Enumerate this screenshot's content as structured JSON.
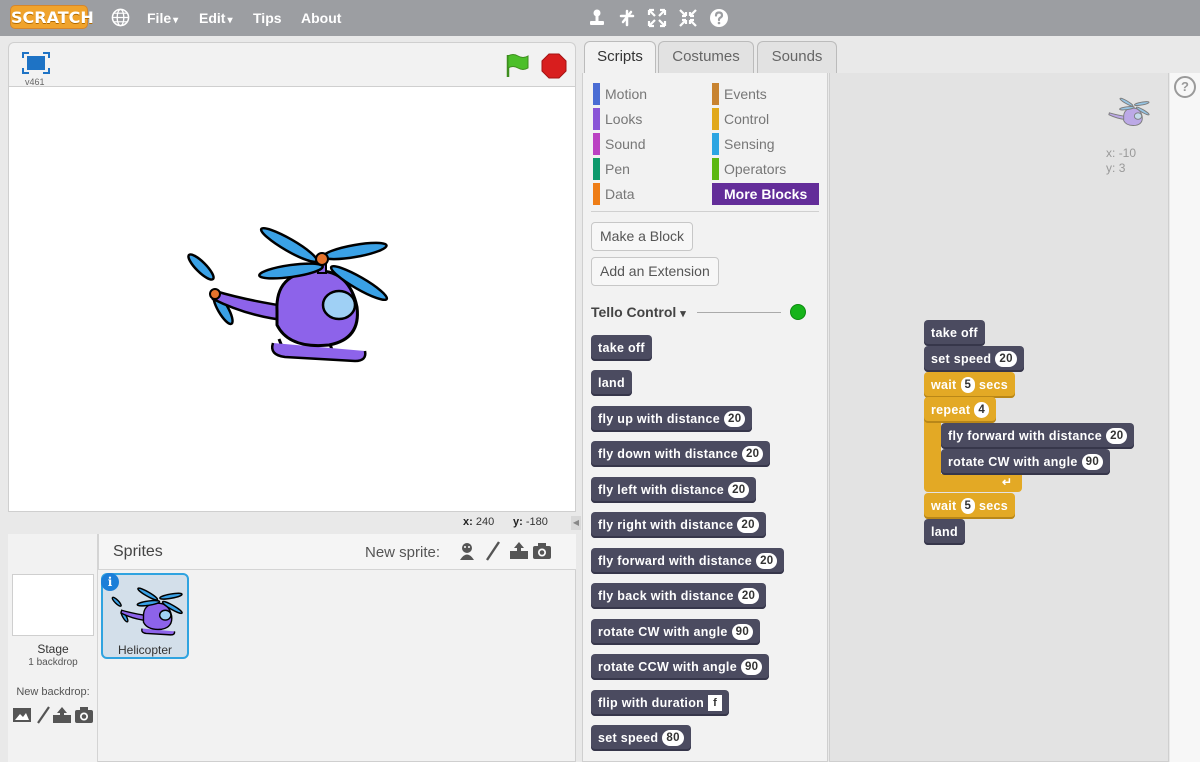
{
  "topbar": {
    "logo": "SCRATCH",
    "menu": [
      {
        "label": "File",
        "arrow": "▾"
      },
      {
        "label": "Edit",
        "arrow": "▾"
      },
      {
        "label": "Tips",
        "arrow": ""
      },
      {
        "label": "About",
        "arrow": ""
      }
    ],
    "tools": [
      "duplicate-stamp-icon",
      "delete-scissors-icon",
      "grow-icon",
      "shrink-icon",
      "help-icon"
    ]
  },
  "stage": {
    "version": "v461",
    "mouse_x_label": "x:",
    "mouse_x": "240",
    "mouse_y_label": "y:",
    "mouse_y": "-180"
  },
  "sprites_pane": {
    "title": "Sprites",
    "new_sprite_label": "New sprite:",
    "stage_label": "Stage",
    "backdrop_count": "1 backdrop",
    "new_backdrop_label": "New backdrop:",
    "sprite_name": "Helicopter",
    "info_glyph": "i"
  },
  "tabs": [
    {
      "label": "Scripts",
      "active": true
    },
    {
      "label": "Costumes",
      "active": false
    },
    {
      "label": "Sounds",
      "active": false
    }
  ],
  "categories": [
    {
      "label": "Motion",
      "color": "#4a6cd4"
    },
    {
      "label": "Looks",
      "color": "#8a55d7"
    },
    {
      "label": "Sound",
      "color": "#bb42c3"
    },
    {
      "label": "Pen",
      "color": "#0e9a6c"
    },
    {
      "label": "Data",
      "color": "#ee7d16"
    },
    {
      "label": "Events",
      "color": "#c88330"
    },
    {
      "label": "Control",
      "color": "#e1a91a"
    },
    {
      "label": "Sensing",
      "color": "#2ca5e2"
    },
    {
      "label": "Operators",
      "color": "#5cb712"
    },
    {
      "label": "More Blocks",
      "color": "#632d99",
      "active": true
    }
  ],
  "palette": {
    "make_block": "Make a Block",
    "add_extension": "Add an Extension",
    "extension_title": "Tello Control",
    "extension_arrow": "▾",
    "blocks": [
      {
        "text": "take off"
      },
      {
        "text": "land"
      },
      {
        "text": "fly up with distance",
        "value": "20"
      },
      {
        "text": "fly down with distance",
        "value": "20"
      },
      {
        "text": "fly left with distance",
        "value": "20"
      },
      {
        "text": "fly right with distance",
        "value": "20"
      },
      {
        "text": "fly forward with distance",
        "value": "20"
      },
      {
        "text": "fly back with distance",
        "value": "20"
      },
      {
        "text": "rotate CW with angle",
        "value": "90"
      },
      {
        "text": "rotate CCW with angle",
        "value": "90"
      },
      {
        "text": "flip with duration",
        "value": "f"
      },
      {
        "text": "set speed",
        "value": "80"
      }
    ]
  },
  "script": {
    "sprite_x_label": "x:",
    "sprite_x": "-10",
    "sprite_y_label": "y:",
    "sprite_y": "3",
    "blocks": [
      {
        "text": "take off"
      },
      {
        "text": "set speed",
        "value": "20"
      },
      {
        "text": "wait",
        "value": "5",
        "suffix": "secs"
      },
      {
        "text": "repeat",
        "value": "4"
      },
      {
        "text": "fly forward with distance",
        "value": "20"
      },
      {
        "text": "rotate CW with angle",
        "value": "90"
      },
      {
        "text": "wait",
        "value": "5",
        "suffix": "secs"
      },
      {
        "text": "land"
      }
    ]
  }
}
